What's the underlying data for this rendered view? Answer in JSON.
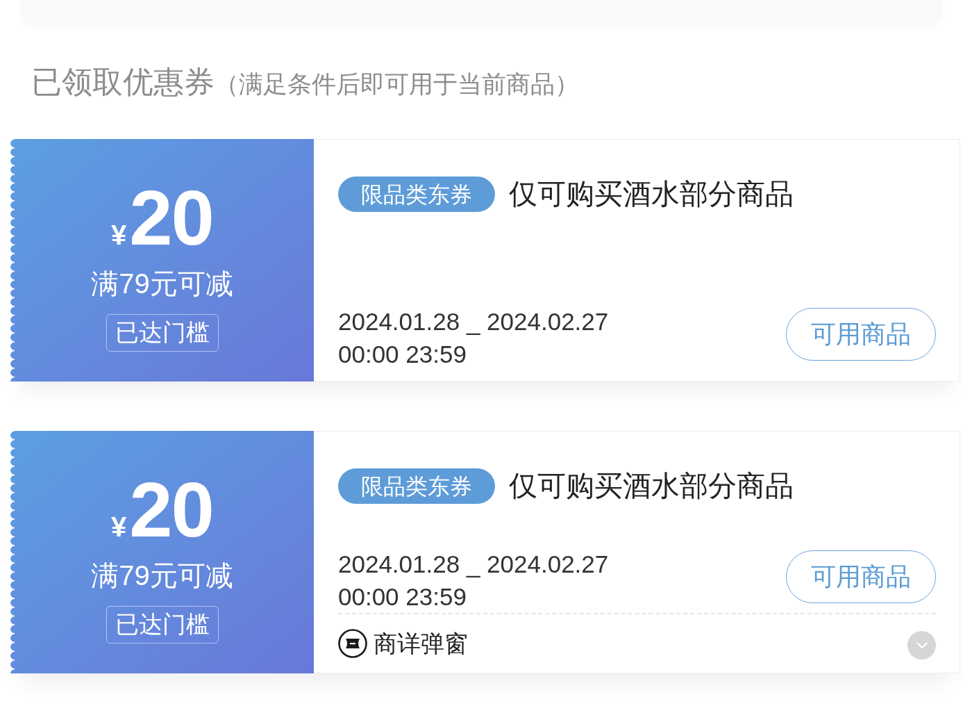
{
  "header": {
    "title": "已领取优惠券",
    "note": "（满足条件后即可用于当前商品）"
  },
  "coupons": [
    {
      "currency": "¥",
      "amount": "20",
      "condition": "满79元可减",
      "threshold_badge": "已达门槛",
      "category_tag": "限品类东券",
      "title": "仅可购买酒水部分商品",
      "validity": [
        "2024.01.28 _ 2024.02.27",
        "00:00 23:59"
      ],
      "button": "可用商品"
    },
    {
      "currency": "¥",
      "amount": "20",
      "condition": "满79元可减",
      "threshold_badge": "已达门槛",
      "category_tag": "限品类东券",
      "title": "仅可购买酒水部分商品",
      "validity": [
        "2024.01.28 _ 2024.02.27",
        "00:00 23:59"
      ],
      "button": "可用商品",
      "footer": {
        "label": "商详弹窗",
        "expanded": false
      }
    }
  ]
}
